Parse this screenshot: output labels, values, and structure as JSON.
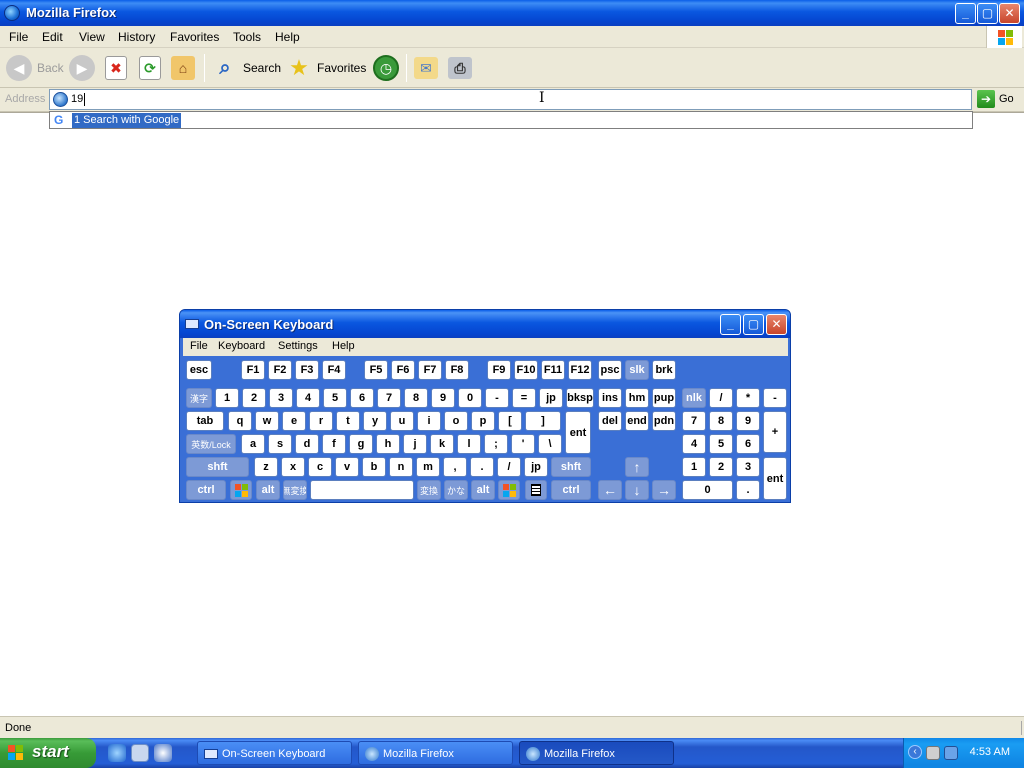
{
  "window": {
    "title": "Mozilla Firefox",
    "buttons": {
      "minimize": "_",
      "maximize": "▢",
      "close": "✕"
    }
  },
  "menu": [
    "File",
    "Edit",
    "View",
    "History",
    "Favorites",
    "Tools",
    "Help"
  ],
  "toolbar": {
    "back": "Back",
    "search": "Search",
    "favorites": "Favorites"
  },
  "address": {
    "label": "Address",
    "value": "19",
    "go": "Go"
  },
  "autocomplete": {
    "item": "1  Search with Google"
  },
  "status": {
    "text": "Done"
  },
  "osk": {
    "title": "On-Screen Keyboard",
    "menu": [
      "File",
      "Keyboard",
      "Settings",
      "Help"
    ],
    "rows": {
      "fn": [
        "esc",
        "F1",
        "F2",
        "F3",
        "F4",
        "F5",
        "F6",
        "F7",
        "F8",
        "F9",
        "F10",
        "F11",
        "F12",
        "psc",
        "slk",
        "brk"
      ],
      "num": [
        "漢字",
        "1",
        "2",
        "3",
        "4",
        "5",
        "6",
        "7",
        "8",
        "9",
        "0",
        "-",
        "=",
        "jp",
        "bksp",
        "ins",
        "hm",
        "pup",
        "nlk",
        "/",
        "*",
        "-"
      ],
      "top": [
        "tab",
        "q",
        "w",
        "e",
        "r",
        "t",
        "y",
        "u",
        "i",
        "o",
        "p",
        "[",
        "]",
        "del",
        "end",
        "pdn",
        "7",
        "8",
        "9",
        "+"
      ],
      "home": [
        "英数/Lock",
        "a",
        "s",
        "d",
        "f",
        "g",
        "h",
        "j",
        "k",
        "l",
        ";",
        "'",
        "\\",
        "ent",
        "4",
        "5",
        "6"
      ],
      "shift": [
        "shft",
        "z",
        "x",
        "c",
        "v",
        "b",
        "n",
        "m",
        ",",
        ".",
        "/",
        "jp",
        "shft",
        "↑",
        "1",
        "2",
        "3",
        "ent"
      ],
      "bottom": [
        "ctrl",
        "alt",
        "無変換",
        "変換",
        "かな",
        "alt",
        "ctrl",
        "←",
        "↓",
        "→",
        "0",
        "."
      ]
    }
  },
  "taskbar": {
    "start": "start",
    "tasks": [
      "On-Screen Keyboard",
      "Mozilla Firefox",
      "Mozilla Firefox"
    ],
    "clock": "4:53 AM"
  },
  "colors": {
    "xp_blue": "#0a57e0",
    "start_green": "#379b37",
    "selection": "#316ac5"
  }
}
